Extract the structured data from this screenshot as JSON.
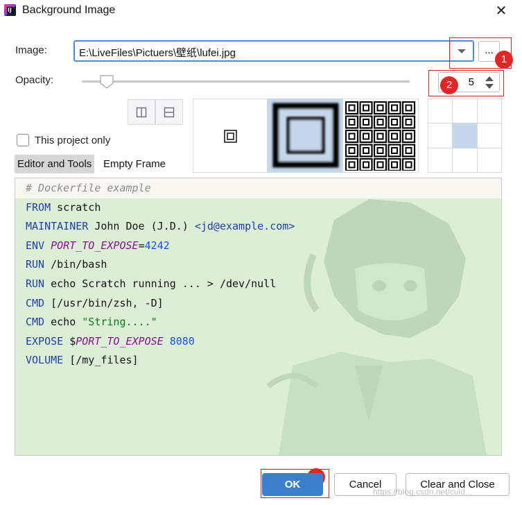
{
  "window": {
    "title": "Background Image",
    "app_icon_text": "IJ",
    "close_glyph": "✕"
  },
  "image": {
    "label": "Image:",
    "path": "E:\\LiveFiles\\Pictuers\\壁纸\\lufei.jpg",
    "browse_label": "..."
  },
  "opacity": {
    "label": "Opacity:",
    "slider_fraction": 0.05,
    "value": "5"
  },
  "options": {
    "project_only_label": "This project only",
    "project_only_checked": false,
    "tabs": [
      {
        "label": "Editor and Tools",
        "active": true
      },
      {
        "label": "Empty Frame",
        "active": false
      }
    ],
    "fill_modes": [
      "scale",
      "center",
      "tile"
    ],
    "selected_fill": "center",
    "placement_selected": "center"
  },
  "preview": {
    "lines": [
      [
        {
          "t": "# Dockerfile example",
          "c": "cmt"
        }
      ],
      [
        {
          "t": "FROM",
          "c": "kw"
        },
        {
          "t": " scratch",
          "c": ""
        }
      ],
      [
        {
          "t": "MAINTAINER",
          "c": "kw"
        },
        {
          "t": " John Doe (J.D.) ",
          "c": ""
        },
        {
          "t": "<jd@example.com>",
          "c": "kw"
        }
      ],
      [
        {
          "t": "ENV",
          "c": "kw"
        },
        {
          "t": " ",
          "c": ""
        },
        {
          "t": "PORT_TO_EXPOSE",
          "c": "var"
        },
        {
          "t": "=",
          "c": ""
        },
        {
          "t": "4242",
          "c": "num"
        }
      ],
      [
        {
          "t": "RUN",
          "c": "kw"
        },
        {
          "t": " /bin/bash",
          "c": ""
        }
      ],
      [
        {
          "t": "RUN",
          "c": "kw"
        },
        {
          "t": " echo Scratch running ... > /dev/null",
          "c": ""
        }
      ],
      [
        {
          "t": "CMD",
          "c": "kw"
        },
        {
          "t": " [/usr/bin/zsh, -D]",
          "c": ""
        }
      ],
      [
        {
          "t": "CMD",
          "c": "kw"
        },
        {
          "t": " echo ",
          "c": ""
        },
        {
          "t": "\"String....\"",
          "c": "str"
        }
      ],
      [
        {
          "t": "EXPOSE",
          "c": "kw"
        },
        {
          "t": " $",
          "c": ""
        },
        {
          "t": "PORT_TO_EXPOSE",
          "c": "var"
        },
        {
          "t": " ",
          "c": ""
        },
        {
          "t": "8080",
          "c": "num"
        }
      ],
      [
        {
          "t": "VOLUME",
          "c": "kw"
        },
        {
          "t": " [/my_files]",
          "c": ""
        }
      ]
    ]
  },
  "annotations": [
    {
      "number": "1"
    },
    {
      "number": "2"
    },
    {
      "number": "3"
    }
  ],
  "buttons": {
    "ok": "OK",
    "cancel": "Cancel",
    "clear_close": "Clear and Close"
  },
  "watermark": "https://blog.csdn.net/cuid...",
  "colors": {
    "accent": "#3d7fcf",
    "annotation": "#e22525",
    "preview_bg": "#dcefd6"
  }
}
